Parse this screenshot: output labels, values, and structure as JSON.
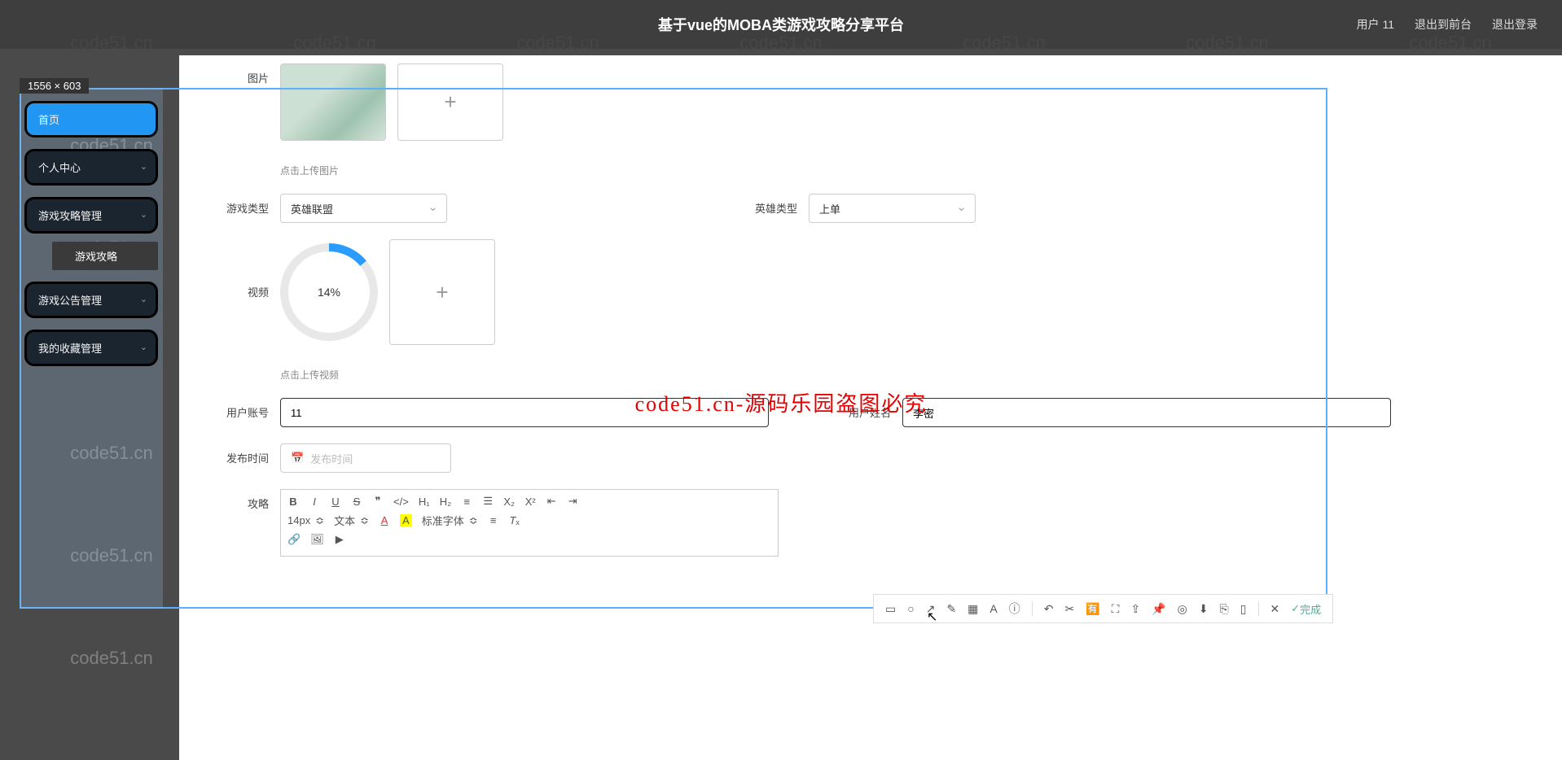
{
  "header": {
    "title": "基于vue的MOBA类游戏攻略分享平台",
    "user_label": "用户 11",
    "logout_front": "退出到前台",
    "logout": "退出登录"
  },
  "dim_badge": "1556 × 603",
  "watermark_text": "code51.cn",
  "center_watermark": "code51.cn-源码乐园盗图必究",
  "sidebar": {
    "home": "首页",
    "profile": "个人中心",
    "guide_mgmt": "游戏攻略管理",
    "guide_sub": "游戏攻略",
    "notice_mgmt": "游戏公告管理",
    "fav_mgmt": "我的收藏管理"
  },
  "form": {
    "image_label": "图片",
    "image_hint": "点击上传图片",
    "game_type_label": "游戏类型",
    "game_type_value": "英雄联盟",
    "hero_type_label": "英雄类型",
    "hero_type_value": "上单",
    "video_label": "视频",
    "video_progress": "14%",
    "video_hint": "点击上传视频",
    "user_account_label": "用户账号",
    "user_account_value": "11",
    "user_name_label": "用户姓名",
    "user_name_value": "李密",
    "publish_time_label": "发布时间",
    "publish_time_placeholder": "发布时间",
    "guide_label": "攻略"
  },
  "editor": {
    "font_size": "14px",
    "font_type": "文本",
    "font_family": "标准字体"
  },
  "float_toolbar": {
    "done": "完成"
  }
}
